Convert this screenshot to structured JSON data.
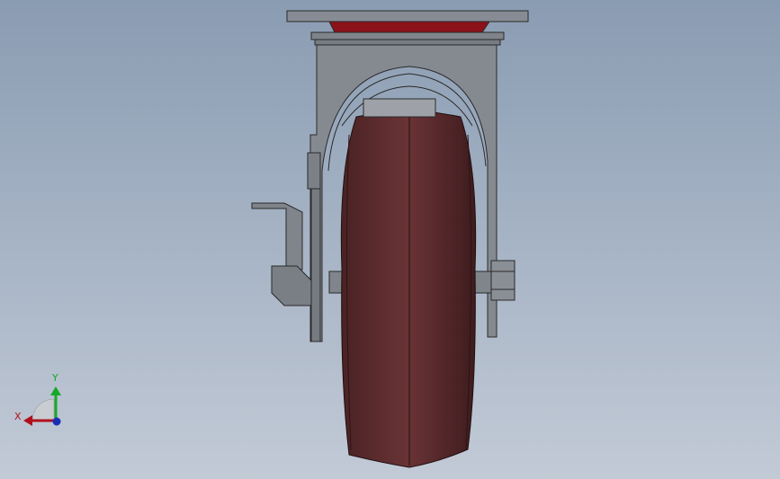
{
  "viewport": {
    "background_top": "#8a9cb2",
    "background_bottom": "#c2cad6"
  },
  "model": {
    "wheel_color": "#5a2a2c",
    "bracket_color": "#858a91",
    "plate_accent_color": "#8a1218"
  },
  "triad": {
    "x_label": "X",
    "y_label": "Y",
    "x_color": "#b0101c",
    "y_color": "#17a82a",
    "z_color": "#1a2fb8"
  }
}
